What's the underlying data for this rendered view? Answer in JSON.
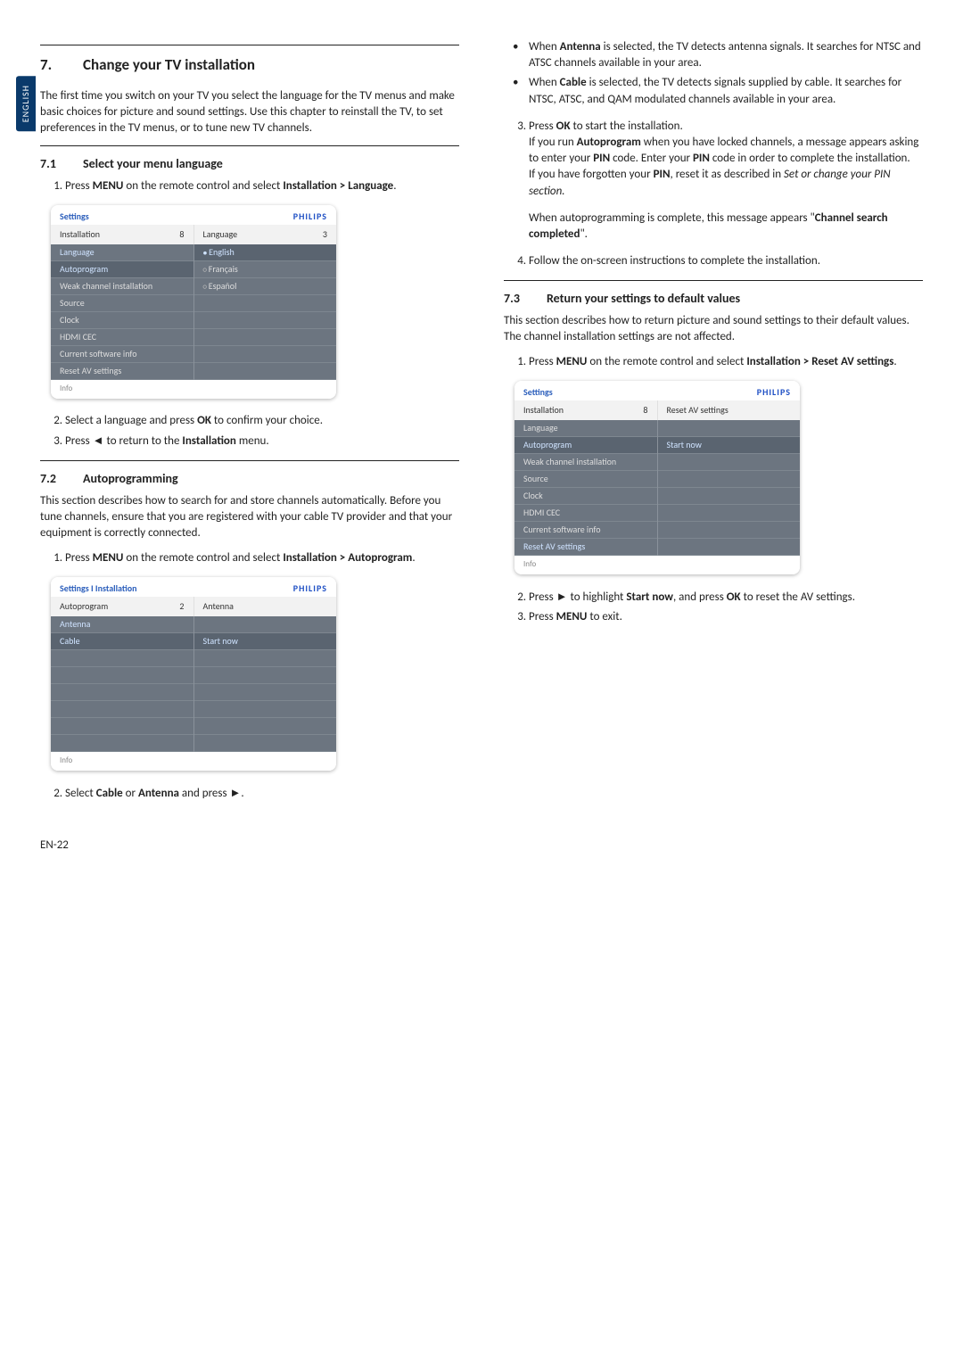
{
  "lang_tab": "ENGLISH",
  "page_number": "EN-22",
  "chapter": {
    "num": "7.",
    "title": "Change your TV installation"
  },
  "intro": "The first time you switch on your TV you select the language for the TV menus and make basic choices for picture and sound settings.  Use this chapter to reinstall the TV, to set preferences in the TV menus, or to tune new TV channels.",
  "s71": {
    "num": "7.1",
    "title": "Select your menu language",
    "step1_a": "Press ",
    "step1_menu": "MENU",
    "step1_b": " on the remote control and select ",
    "step1_path": "Installation > Language",
    "step1_dot": ".",
    "step2_a": "Select a language and press ",
    "step2_ok": "OK",
    "step2_b": " to confirm your choice.",
    "step3_a": "Press ",
    "step3_tri": "◄",
    "step3_b": " to return to the ",
    "step3_bold": "Installation",
    "step3_c": " menu."
  },
  "menu1": {
    "settings": "Settings",
    "brand": "PHILIPS",
    "left_title": "Installation",
    "left_count": "8",
    "right_title": "Language",
    "right_count": "3",
    "left_items": [
      "Language",
      "Autoprogram",
      "Weak channel installation",
      "Source",
      "Clock",
      "HDMI CEC",
      "Current software info",
      "Reset AV settings"
    ],
    "left_selected": 0,
    "right_items": [
      "English",
      "Français",
      "Español"
    ],
    "right_selected": 0,
    "foot": "Info"
  },
  "s72": {
    "num": "7.2",
    "title": "Autoprogramming",
    "intro": "This section describes how to search for and store channels automatically.  Before you tune channels, ensure that you are registered with your cable TV provider and that your equipment is correctly connected.",
    "step1_a": "Press ",
    "step1_menu": "MENU",
    "step1_b": " on the remote control and select ",
    "step1_path": "Installation > Autoprogram",
    "step1_dot": ".",
    "step2_a": "Select ",
    "step2_cable": "Cable",
    "step2_or": " or ",
    "step2_ant": "Antenna",
    "step2_b": " and press ",
    "step2_tri": "►",
    "step2_dot": "."
  },
  "menu2": {
    "settings": "Settings I Installation",
    "brand": "PHILIPS",
    "left_title": "Autoprogram",
    "left_count": "2",
    "right_title": "Antenna",
    "right_count": "",
    "left_items": [
      "Antenna",
      "Cable",
      "",
      "",
      "",
      "",
      "",
      ""
    ],
    "left_selected": 0,
    "right_items": [
      "",
      "Start now",
      "",
      "",
      "",
      "",
      "",
      ""
    ],
    "foot": "Info"
  },
  "rightcol": {
    "bullet1_a": "When ",
    "bullet1_b": "Antenna",
    "bullet1_c": " is selected, the TV detects antenna signals.  It searches for NTSC and ATSC channels available in your area.",
    "bullet2_a": "When ",
    "bullet2_b": "Cable",
    "bullet2_c": " is selected, the TV detects signals supplied by cable.  It searches for NTSC, ATSC, and QAM modulated channels available in your area.",
    "step3_a": "Press ",
    "step3_ok": "OK",
    "step3_b": " to start the installation.",
    "step3_l2a": "If you run ",
    "step3_l2b": "Autoprogram",
    "step3_l2c": " when you have locked channels, a message appears asking to enter your ",
    "step3_pin1": "PIN",
    "step3_l2d": " code.  Enter your ",
    "step3_pin2": "PIN",
    "step3_l2e": " code in order to complete the installation.",
    "step3_l3a": "If you have forgotten your ",
    "step3_l3pin": "PIN",
    "step3_l3b": ", reset it as described in ",
    "step3_l3i": "Set or change your PIN section.",
    "step3_p2a": "When autoprogramming is complete, this message appears \"",
    "step3_p2b": "Channel search completed",
    "step3_p2c": "\".",
    "step4": "Follow the on-screen instructions to complete the installation."
  },
  "s73": {
    "num": "7.3",
    "title": "Return your settings to default values",
    "intro": "This section describes how to return picture and sound settings to their default values.  The channel installation settings are not affected.",
    "step1_a": "Press ",
    "step1_menu": "MENU",
    "step1_b": " on the remote control and select ",
    "step1_path": "Installation > Reset AV settings",
    "step1_dot": ".",
    "step2_a": "Press ",
    "step2_tri": "►",
    "step2_b": " to highlight ",
    "step2_start": "Start now",
    "step2_c": ", and press ",
    "step2_ok": "OK",
    "step2_d": " to reset the AV settings.",
    "step3_a": "Press ",
    "step3_menu": "MENU",
    "step3_b": " to exit."
  },
  "menu3": {
    "settings": "Settings",
    "brand": "PHILIPS",
    "left_title": "Installation",
    "left_count": "8",
    "right_title": "Reset AV settings",
    "right_count": "",
    "left_items": [
      "Language",
      "Autoprogram",
      "Weak channel installation",
      "Source",
      "Clock",
      "HDMI CEC",
      "Current software info",
      "Reset AV settings"
    ],
    "left_selected": 7,
    "right_items": [
      "",
      "Start now",
      "",
      "",
      "",
      "",
      "",
      ""
    ],
    "foot": "Info"
  }
}
